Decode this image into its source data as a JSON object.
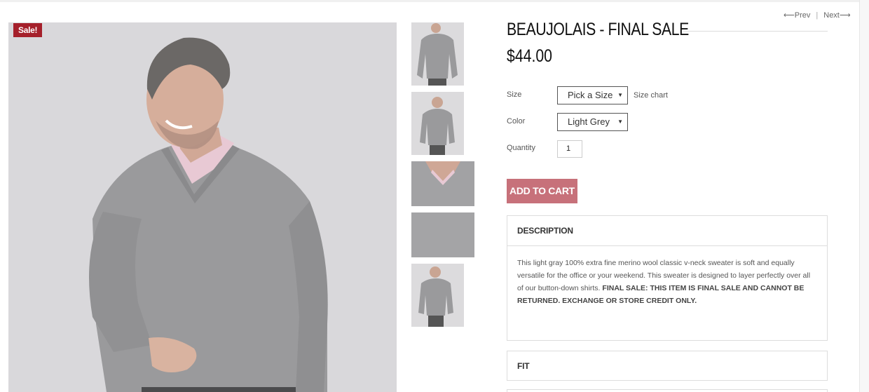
{
  "badge": {
    "sale": "Sale!"
  },
  "nav": {
    "prev": "⟵Prev",
    "separator": "|",
    "next": "Next⟶"
  },
  "product": {
    "title": "BEAUJOLAIS - FINAL SALE",
    "price": "$44.00"
  },
  "options": {
    "size_label": "Size",
    "size_value": "Pick a Size",
    "size_chart": "Size chart",
    "color_label": "Color",
    "color_value": "Light Grey",
    "quantity_label": "Quantity",
    "quantity_value": "1"
  },
  "cart": {
    "label": "ADD TO CART"
  },
  "description": {
    "heading": "DESCRIPTION",
    "text": "This light gray 100% extra fine merino wool classic v-neck sweater is soft and equally versatile for the office or your weekend. This sweater is designed to layer perfectly over all of our button-down shirts. ",
    "bold": "FINAL SALE: THIS ITEM IS FINAL SALE AND CANNOT BE RETURNED. EXCHANGE OR STORE CREDIT ONLY."
  },
  "fit": {
    "heading": "FIT"
  },
  "colors": {
    "sale_badge": "#a5202b",
    "add_to_cart": "#c7717a",
    "sweater": "#9a9a9c",
    "background": "#d9d8db"
  }
}
